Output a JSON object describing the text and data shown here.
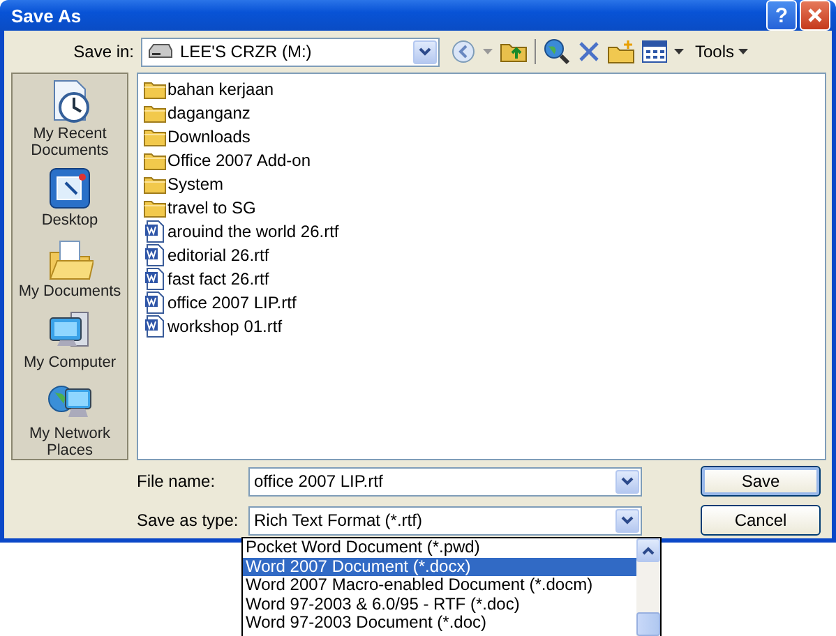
{
  "window": {
    "title": "Save As",
    "help_label": "?"
  },
  "toolbar": {
    "save_in_label": "Save in:",
    "location": "LEE'S CRZR (M:)",
    "tools_label": "Tools"
  },
  "places": [
    {
      "label": "My Recent Documents",
      "kind": "recent"
    },
    {
      "label": "Desktop",
      "kind": "desktop"
    },
    {
      "label": "My Documents",
      "kind": "documents"
    },
    {
      "label": "My Computer",
      "kind": "computer"
    },
    {
      "label": "My Network Places",
      "kind": "network"
    }
  ],
  "files": [
    {
      "name": "bahan kerjaan",
      "kind": "folder"
    },
    {
      "name": "daganganz",
      "kind": "folder"
    },
    {
      "name": "Downloads",
      "kind": "folder"
    },
    {
      "name": "Office 2007 Add-on",
      "kind": "folder"
    },
    {
      "name": "System",
      "kind": "folder"
    },
    {
      "name": "travel to SG",
      "kind": "folder"
    },
    {
      "name": "arouind the world 26.rtf",
      "kind": "document"
    },
    {
      "name": "editorial 26.rtf",
      "kind": "document"
    },
    {
      "name": "fast fact 26.rtf",
      "kind": "document"
    },
    {
      "name": "office 2007 LIP.rtf",
      "kind": "document"
    },
    {
      "name": "workshop 01.rtf",
      "kind": "document"
    }
  ],
  "file_name": {
    "label": "File name:",
    "value": "office 2007 LIP.rtf"
  },
  "save_type": {
    "label": "Save as type:",
    "value": "Rich Text Format (*.rtf)",
    "options": [
      {
        "label": "Pocket Word Document (*.pwd)",
        "selected": false
      },
      {
        "label": "Word 2007 Document (*.docx)",
        "selected": true
      },
      {
        "label": "Word 2007 Macro-enabled Document (*.docm)",
        "selected": false
      },
      {
        "label": "Word 97-2003 & 6.0/95 - RTF (*.doc)",
        "selected": false
      },
      {
        "label": "Word 97-2003 Document (*.doc)",
        "selected": false
      }
    ]
  },
  "buttons": [
    {
      "label": "Save",
      "default": true
    },
    {
      "label": "Cancel",
      "default": false
    }
  ]
}
